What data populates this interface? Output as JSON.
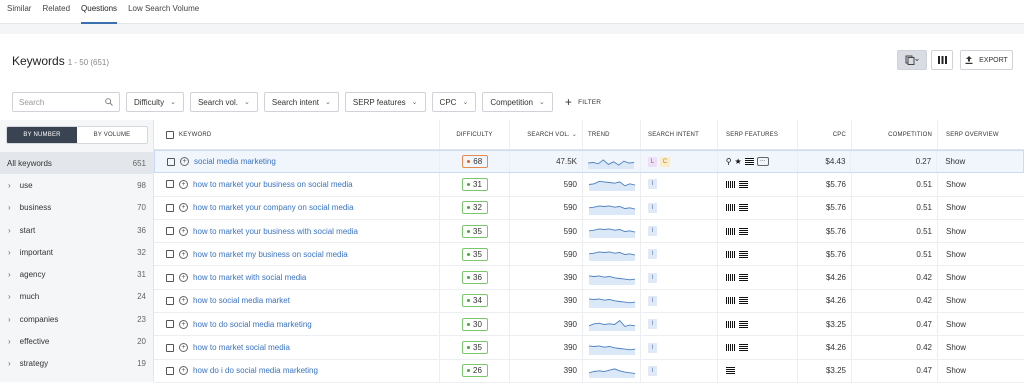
{
  "tabs": [
    "Similar",
    "Related",
    "Questions",
    "Low Search Volume"
  ],
  "active_tab": "Questions",
  "title": "Keywords",
  "title_sub": "1 - 50 (651)",
  "header_buttons": {
    "export": "EXPORT"
  },
  "search_placeholder": "Search",
  "filters": [
    "Difficulty",
    "Search vol.",
    "Search intent",
    "SERP features",
    "CPC",
    "Competition"
  ],
  "filter_link": "FILTER",
  "toggle": {
    "by_number": "BY NUMBER",
    "by_volume": "BY VOLUME",
    "active": "BY NUMBER"
  },
  "groups": [
    {
      "label": "All keywords",
      "count": "651"
    },
    {
      "label": "use",
      "count": "98"
    },
    {
      "label": "business",
      "count": "70"
    },
    {
      "label": "start",
      "count": "36"
    },
    {
      "label": "important",
      "count": "32"
    },
    {
      "label": "agency",
      "count": "31"
    },
    {
      "label": "much",
      "count": "24"
    },
    {
      "label": "companies",
      "count": "23"
    },
    {
      "label": "effective",
      "count": "20"
    },
    {
      "label": "strategy",
      "count": "19"
    }
  ],
  "columns": {
    "keyword": "KEYWORD",
    "difficulty": "DIFFICULTY",
    "volume": "SEARCH VOL.",
    "trend": "TREND",
    "intent": "SEARCH INTENT",
    "serp": "SERP FEATURES",
    "cpc": "CPC",
    "competition": "COMPETITION",
    "overview": "SERP OVERVIEW"
  },
  "rows": [
    {
      "keyword": "social media marketing",
      "difficulty": "68",
      "volume": "47.5K",
      "intent": [
        "L",
        "C"
      ],
      "serp": "set1",
      "cpc": "$4.43",
      "competition": "0.27",
      "overview": "Show",
      "trend": [
        0.45,
        0.5,
        0.4,
        0.7,
        0.35,
        0.55,
        0.3,
        0.6,
        0.45,
        0.5
      ]
    },
    {
      "keyword": "how to market your business on social media",
      "difficulty": "31",
      "volume": "590",
      "intent": [
        "I"
      ],
      "serp": "set2",
      "cpc": "$5.76",
      "competition": "0.51",
      "overview": "Show",
      "trend": [
        0.5,
        0.55,
        0.75,
        0.7,
        0.65,
        0.6,
        0.7,
        0.4,
        0.55,
        0.45
      ]
    },
    {
      "keyword": "how to market your company on social media",
      "difficulty": "32",
      "volume": "590",
      "intent": [
        "I"
      ],
      "serp": "set2",
      "cpc": "$5.76",
      "competition": "0.51",
      "overview": "Show",
      "trend": [
        0.55,
        0.6,
        0.7,
        0.65,
        0.7,
        0.6,
        0.65,
        0.5,
        0.55,
        0.45
      ]
    },
    {
      "keyword": "how to market your business with social media",
      "difficulty": "35",
      "volume": "590",
      "intent": [
        "I"
      ],
      "serp": "set2",
      "cpc": "$5.76",
      "competition": "0.51",
      "overview": "Show",
      "trend": [
        0.55,
        0.6,
        0.7,
        0.65,
        0.7,
        0.6,
        0.65,
        0.5,
        0.55,
        0.45
      ]
    },
    {
      "keyword": "how to market my business on social media",
      "difficulty": "35",
      "volume": "590",
      "intent": [
        "I"
      ],
      "serp": "set2",
      "cpc": "$5.76",
      "competition": "0.51",
      "overview": "Show",
      "trend": [
        0.55,
        0.6,
        0.7,
        0.65,
        0.7,
        0.6,
        0.65,
        0.5,
        0.55,
        0.45
      ]
    },
    {
      "keyword": "how to market with social media",
      "difficulty": "36",
      "volume": "390",
      "intent": [
        "I"
      ],
      "serp": "set2",
      "cpc": "$4.26",
      "competition": "0.42",
      "overview": "Show",
      "trend": [
        0.7,
        0.65,
        0.7,
        0.6,
        0.65,
        0.55,
        0.5,
        0.45,
        0.4,
        0.45
      ]
    },
    {
      "keyword": "how to social media market",
      "difficulty": "34",
      "volume": "390",
      "intent": [
        "I"
      ],
      "serp": "set2",
      "cpc": "$4.26",
      "competition": "0.42",
      "overview": "Show",
      "trend": [
        0.7,
        0.65,
        0.7,
        0.6,
        0.65,
        0.55,
        0.5,
        0.45,
        0.4,
        0.45
      ]
    },
    {
      "keyword": "how to do social media marketing",
      "difficulty": "30",
      "volume": "390",
      "intent": [
        "I"
      ],
      "serp": "set2",
      "cpc": "$3.25",
      "competition": "0.47",
      "overview": "Show",
      "trend": [
        0.4,
        0.55,
        0.6,
        0.5,
        0.55,
        0.5,
        0.8,
        0.35,
        0.45,
        0.4
      ]
    },
    {
      "keyword": "how to market social media",
      "difficulty": "35",
      "volume": "390",
      "intent": [
        "I"
      ],
      "serp": "set2",
      "cpc": "$4.26",
      "competition": "0.42",
      "overview": "Show",
      "trend": [
        0.7,
        0.65,
        0.7,
        0.6,
        0.65,
        0.55,
        0.5,
        0.45,
        0.4,
        0.45
      ]
    },
    {
      "keyword": "how do i do social media marketing",
      "difficulty": "26",
      "volume": "390",
      "intent": [
        "I"
      ],
      "serp": "set3",
      "cpc": "$3.25",
      "competition": "0.47",
      "overview": "Show",
      "trend": [
        0.4,
        0.5,
        0.55,
        0.5,
        0.6,
        0.7,
        0.55,
        0.45,
        0.4,
        0.35
      ]
    }
  ]
}
